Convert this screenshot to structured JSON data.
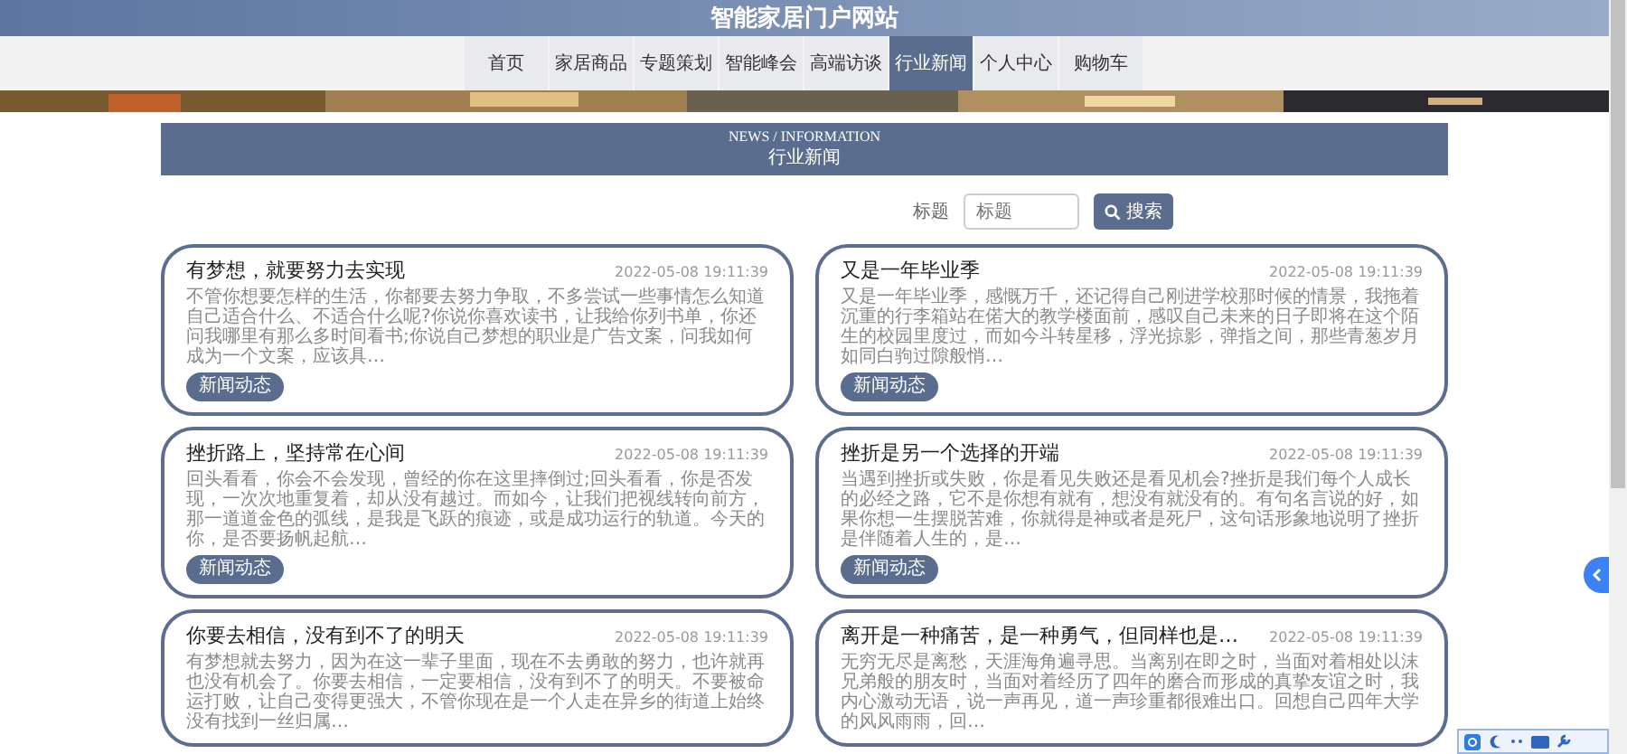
{
  "site_title": "智能家居门户网站",
  "nav": [
    {
      "label": "首页",
      "selected": false
    },
    {
      "label": "家居商品",
      "selected": false
    },
    {
      "label": "专题策划",
      "selected": false
    },
    {
      "label": "智能峰会",
      "selected": false
    },
    {
      "label": "高端访谈",
      "selected": false
    },
    {
      "label": "行业新闻",
      "selected": true
    },
    {
      "label": "个人中心",
      "selected": false
    },
    {
      "label": "购物车",
      "selected": false
    }
  ],
  "section": {
    "title_en": "NEWS / INFORMATION",
    "title": "行业新闻"
  },
  "search": {
    "label": "标题",
    "placeholder": "标题",
    "button": "搜索"
  },
  "news": [
    {
      "title": "有梦想，就要努力去实现",
      "date": "2022-05-08 19:11:39",
      "summary": "不管你想要怎样的生活，你都要去努力争取，不多尝试一些事情怎么知道自己适合什么、不适合什么呢?你说你喜欢读书，让我给你列书单，你还问我哪里有那么多时间看书;你说自己梦想的职业是广告文案，问我如何成为一个文案，应该具…",
      "tag": "新闻动态"
    },
    {
      "title": "又是一年毕业季",
      "date": "2022-05-08 19:11:39",
      "summary": "又是一年毕业季，感慨万千，还记得自己刚进学校那时候的情景，我拖着沉重的行李箱站在偌大的教学楼面前，感叹自己未来的日子即将在这个陌生的校园里度过，而如今斗转星移，浮光掠影，弹指之间，那些青葱岁月如同白驹过隙般悄…",
      "tag": "新闻动态"
    },
    {
      "title": "挫折路上，坚持常在心间",
      "date": "2022-05-08 19:11:39",
      "summary": "回头看看，你会不会发现，曾经的你在这里摔倒过;回头看看，你是否发现，一次次地重复着，却从没有越过。而如今，让我们把视线转向前方，那一道道金色的弧线，是我是飞跃的痕迹，或是成功运行的轨道。今天的你，是否要扬帆起航…",
      "tag": "新闻动态"
    },
    {
      "title": "挫折是另一个选择的开端",
      "date": "2022-05-08 19:11:39",
      "summary": "当遇到挫折或失败，你是看见失败还是看见机会?挫折是我们每个人成长的必经之路，它不是你想有就有，想没有就没有的。有句名言说的好，如果你想一生摆脱苦难，你就得是神或者是死尸，这句话形象地说明了挫折是伴随着人生的，是…",
      "tag": "新闻动态"
    },
    {
      "title": "你要去相信，没有到不了的明天",
      "date": "2022-05-08 19:11:39",
      "summary": "有梦想就去努力，因为在这一辈子里面，现在不去勇敢的努力，也许就再也没有机会了。你要去相信，一定要相信，没有到不了的明天。不要被命运打败，让自己变得更强大，不管你现在是一个人走在异乡的街道上始终没有找到一丝归属…"
    },
    {
      "title": "离开是一种痛苦，是一种勇气，但同样也是…",
      "date": "2022-05-08 19:11:39",
      "summary": "无穷无尽是离愁，天涯海角遍寻思。当离别在即之时，当面对着相处以沫兄弟般的朋友时，当面对着经历了四年的磨合而形成的真挚友谊之时，我内心激动无语，说一声再见，道一声珍重都很难出口。回想自己四年大学的风风雨雨，回…"
    }
  ]
}
